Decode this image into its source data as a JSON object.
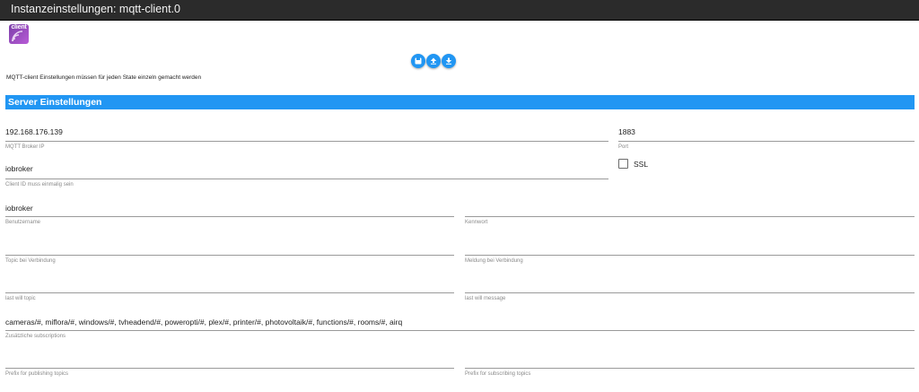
{
  "window": {
    "title": "Instanzeinstellungen: mqtt-client.0"
  },
  "logo": {
    "text": "client"
  },
  "toolbar": {
    "buttons": [
      {
        "icon": "save-icon"
      },
      {
        "icon": "upload-icon"
      },
      {
        "icon": "download-icon"
      }
    ],
    "color": "#2196f3"
  },
  "note": "MQTT-client Einstellungen müssen für jeden State einzeln gemacht werden",
  "section": {
    "title": "Server Einstellungen",
    "color": "#2196f3"
  },
  "fields": {
    "broker_ip": {
      "value": "192.168.176.139",
      "label": "MQTT Broker IP"
    },
    "port": {
      "value": "1883",
      "label": "Port"
    },
    "ssl": {
      "label": "SSL",
      "checked": false
    },
    "client_id": {
      "value": "iobroker",
      "label": "Client ID muss einmalig sein"
    },
    "username": {
      "value": "iobroker",
      "label": "Benutzername"
    },
    "password": {
      "value": "",
      "label": "Kennwort"
    },
    "connect_topic": {
      "value": "",
      "label": "Topic bei Verbindung"
    },
    "connect_message": {
      "value": "",
      "label": "Meldung bei Verbindung"
    },
    "last_will_topic": {
      "value": "",
      "label": "last will topic"
    },
    "last_will_message": {
      "value": "",
      "label": "last will message"
    },
    "subscriptions": {
      "value": "cameras/#, miflora/#, windows/#, tvheadend/#, poweropti/#, plex/#, printer/#, photovoltaik/#, functions/#, rooms/#, airq",
      "label": "Zusätzliche subscriptions"
    },
    "publish_prefix": {
      "value": "",
      "label": "Prefix for publishing topics"
    },
    "subscribe_prefix": {
      "value": "",
      "label": "Prefix for subscribing topics"
    }
  }
}
